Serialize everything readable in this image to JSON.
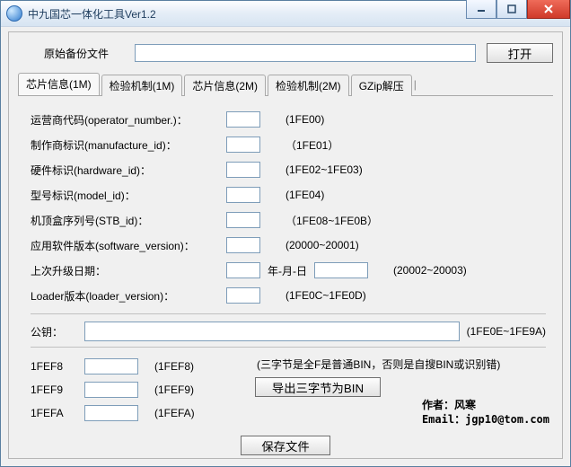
{
  "window": {
    "title": "中九国芯一体化工具Ver1.2"
  },
  "open": {
    "label": "原始备份文件",
    "button": "打开",
    "value": ""
  },
  "tabs": [
    "芯片信息(1M)",
    "检验机制(1M)",
    "芯片信息(2M)",
    "检验机制(2M)",
    "GZip解压"
  ],
  "fields": {
    "operator": {
      "label": "运营商代码(operator_number.)：",
      "value": "",
      "hint": "(1FE00)"
    },
    "manu": {
      "label": "制作商标识(manufacture_id)：",
      "value": "",
      "hint": "（1FE01）"
    },
    "hardware": {
      "label": "硬件标识(hardware_id)：",
      "value": "",
      "hint": "(1FE02~1FE03)"
    },
    "model": {
      "label": "型号标识(model_id)：",
      "value": "",
      "hint": "(1FE04)"
    },
    "stb": {
      "label": "机顶盒序列号(STB_id)：",
      "value": "",
      "hint": "（1FE08~1FE0B）"
    },
    "sw": {
      "label": "应用软件版本(software_version)：",
      "value": "",
      "hint": "(20000~20001)"
    },
    "date": {
      "label": "上次升级日期：",
      "v1": "",
      "mid": "年-月-日",
      "v2": "",
      "hint": "(20002~20003)"
    },
    "loader": {
      "label": "Loader版本(loader_version)：",
      "value": "",
      "hint": "(1FE0C~1FE0D)"
    },
    "pubkey": {
      "label": "公钥：",
      "value": "",
      "hint": "(1FE0E~1FE9A)"
    }
  },
  "triple": {
    "r1": {
      "label": "1FEF8",
      "value": "",
      "hint": "(1FEF8)"
    },
    "r2": {
      "label": "1FEF9",
      "value": "",
      "hint": "(1FEF9)"
    },
    "r3": {
      "label": "1FEFA",
      "value": "",
      "hint": "(1FEFA)"
    }
  },
  "note": "(三字节是全F是普通BIN，否则是自搜BIN或识别错)",
  "export_btn": "导出三字节为BIN",
  "save_btn": "保存文件",
  "credits": {
    "author_label": "作者：",
    "author": "风寒",
    "email_label": "Email：",
    "email": "jgp10@tom.com"
  }
}
